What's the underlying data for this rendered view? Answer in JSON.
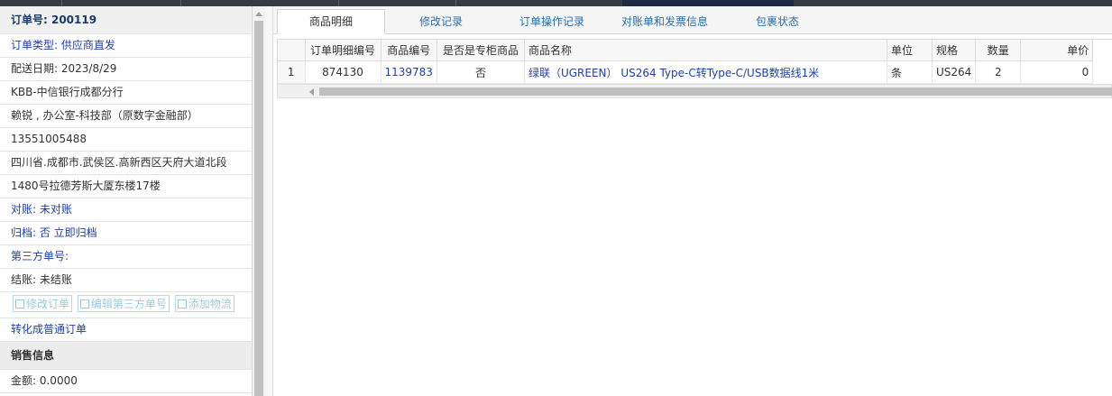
{
  "order": {
    "title": "订单号: 200119",
    "type_line": "订单类型: 供应商直发",
    "delivery_date": "配送日期: 2023/8/29",
    "branch": "KBB-中信银行成都分行",
    "contact": "赖锐 , 办公室-科技部（原数字金融部）",
    "phone": "13551005488",
    "address_1": "四川省.成都市.武侯区.高新西区天府大道北段",
    "address_2": "1480号拉德芳斯大厦东楼17楼",
    "reconcile": "对账: 未对账",
    "archive": "归档: 否 立即归档",
    "third_party": "第三方单号:",
    "settlement": "结账: 未结账",
    "buttons": [
      "修改订单",
      "编辑第三方单号",
      "添加物流"
    ],
    "convert_link": "转化成普通订单",
    "sales_section": "销售信息",
    "amount": "金额: 0.0000"
  },
  "tabs": [
    "商品明细",
    "修改记录",
    "订单操作记录",
    "对账单和发票信息",
    "包裹状态"
  ],
  "active_tab": "商品明细",
  "table": {
    "headers": [
      "订单明细编号",
      "商品编号",
      "是否是专柜商品",
      "商品名称",
      "单位",
      "规格",
      "数量",
      "单价"
    ],
    "rows": [
      {
        "rownum": "1",
        "detail_id": "874130",
        "product_id": "1139783",
        "counter": "否",
        "name": "绿联（UGREEN） US264 Type-C转Type-C/USB数据线1米",
        "unit": "条",
        "spec": "US264",
        "qty": "2",
        "price": "0"
      }
    ]
  }
}
